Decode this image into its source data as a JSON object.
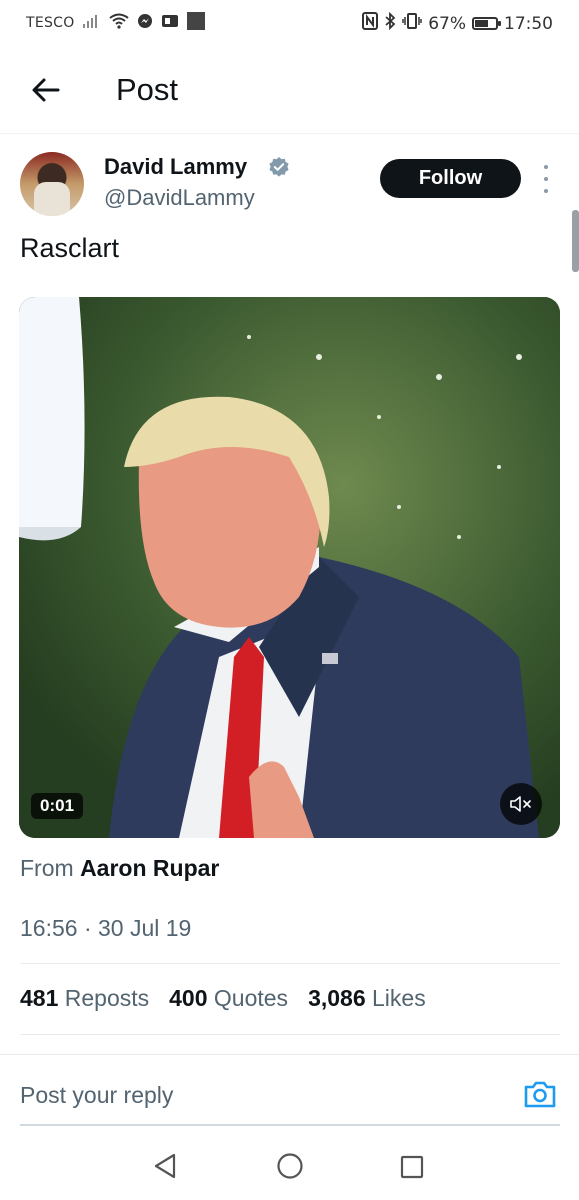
{
  "status_bar": {
    "carrier": "TESCO",
    "battery": "67%",
    "battery_level": 0.67,
    "time": "17:50"
  },
  "header": {
    "title": "Post"
  },
  "post": {
    "author_name": "David Lammy",
    "author_handle": "@DavidLammy",
    "follow_label": "Follow",
    "text": "Rasclart",
    "video": {
      "timestamp": "0:01"
    },
    "source_prefix": "From",
    "source_name": "Aaron Rupar",
    "date": "16:56 · 30 Jul 19",
    "stats": {
      "reposts_count": "481",
      "reposts_label": "Reposts",
      "quotes_count": "400",
      "quotes_label": "Quotes",
      "likes_count": "3,086",
      "likes_label": "Likes"
    }
  },
  "reply": {
    "placeholder": "Post your reply"
  },
  "icons": {
    "back": "arrow-left-icon",
    "verified": "verified-badge-icon",
    "more": "more-vertical-icon",
    "mute": "volume-muted-icon",
    "camera": "camera-icon"
  },
  "colors": {
    "accent": "#1d9bf0",
    "text_primary": "#0f1419",
    "text_secondary": "#536471",
    "follow_bg": "#0f1419",
    "verified": "#829aab"
  }
}
